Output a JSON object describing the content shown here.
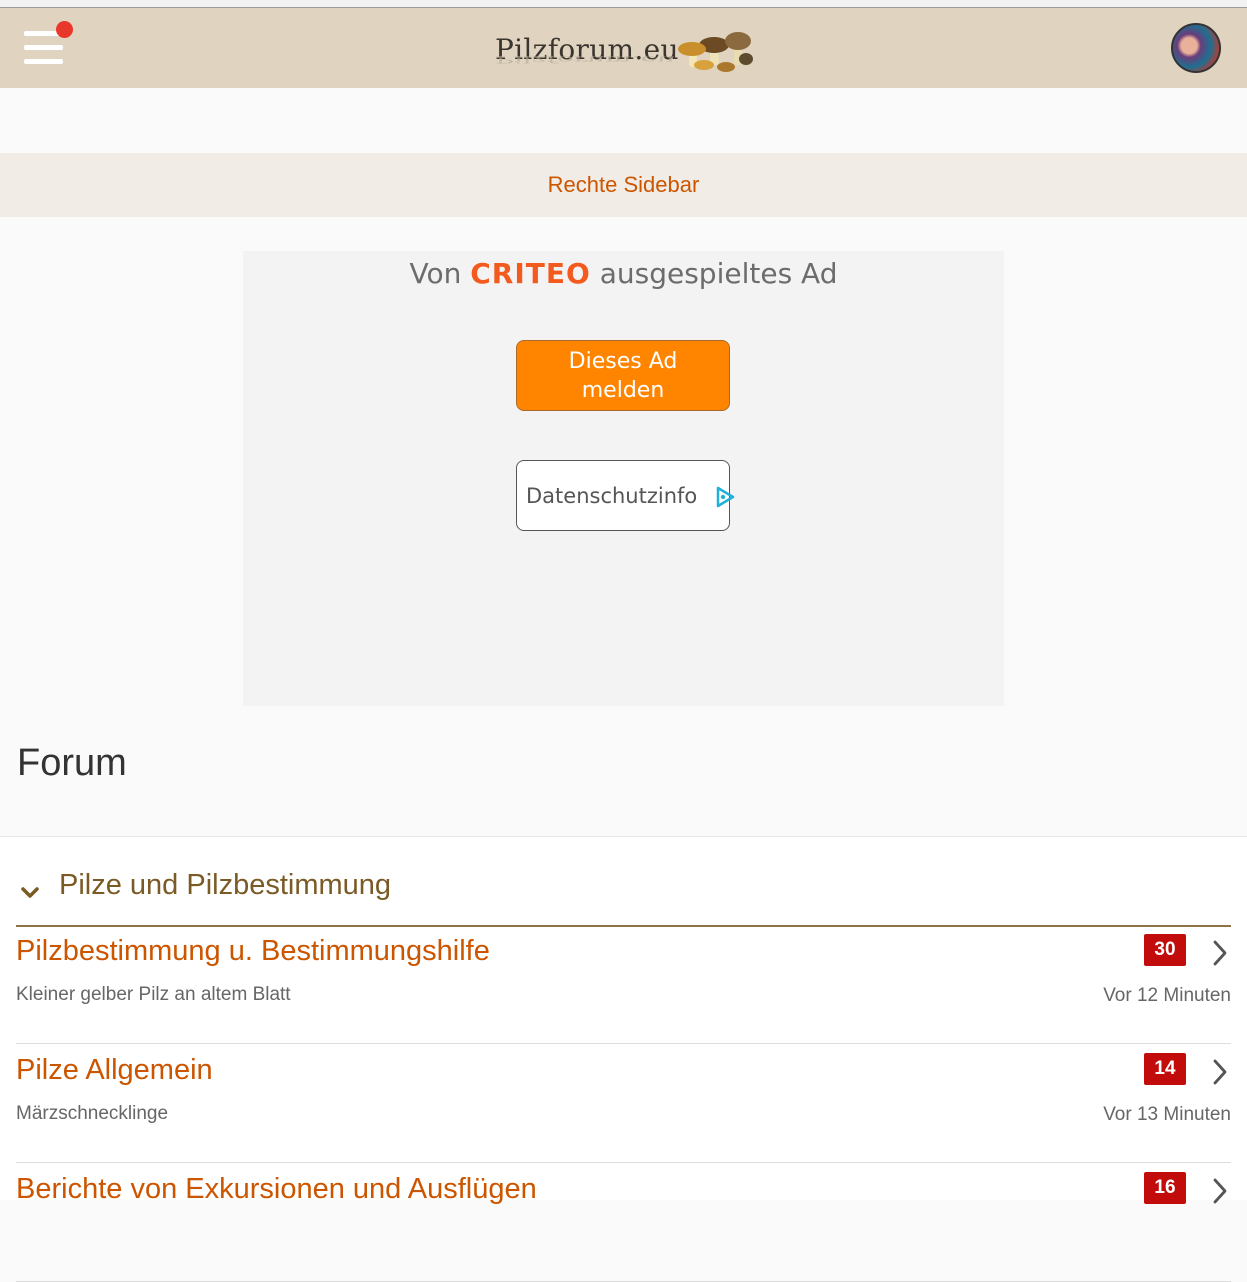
{
  "header": {
    "logo_text": "Pilzforum.eu",
    "menu_label": "Menü",
    "avatar_alt": "Profilbild"
  },
  "sidebar": {
    "label": "Rechte Sidebar"
  },
  "ad": {
    "prefix": "Von",
    "brand": "CRITEO",
    "suffix": "ausgespieltes Ad",
    "report_line1": "Dieses Ad",
    "report_line2": "melden",
    "privacy_label": "Datenschutzinfo"
  },
  "page": {
    "title": "Forum"
  },
  "category": {
    "title": "Pilze und Pilzbestimmung",
    "boards": [
      {
        "title": "Pilzbestimmung u. Bestimmungshilfe",
        "subtitle": "Kleiner gelber Pilz an altem Blatt",
        "badge": "30",
        "time": "Vor 12 Minuten"
      },
      {
        "title": "Pilze Allgemein",
        "subtitle": "Märzschnecklinge",
        "badge": "14",
        "time": "Vor 13 Minuten"
      },
      {
        "title": "Berichte von Exkursionen und Ausflügen",
        "subtitle": "",
        "badge": "16",
        "time": ""
      }
    ]
  },
  "colors": {
    "accent": "#cc5500",
    "header_bg": "#e0d4c1",
    "badge": "#c20c0c",
    "ad_button": "#ff8500"
  }
}
